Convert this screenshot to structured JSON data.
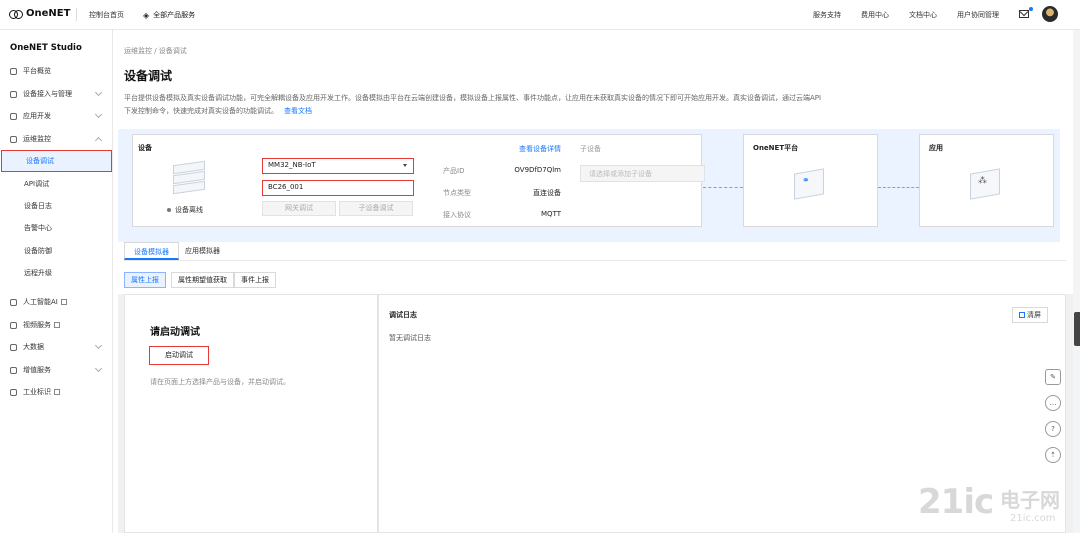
{
  "topbar": {
    "logo": "OneNET",
    "console_home": "控制台首页",
    "all_products": "全部产品服务",
    "right_links": [
      "服务支持",
      "费用中心",
      "文档中心",
      "用户协同管理"
    ]
  },
  "sidebar": {
    "title": "OneNET Studio",
    "items": [
      {
        "label": "平台概览"
      },
      {
        "label": "设备接入与管理"
      },
      {
        "label": "应用开发"
      },
      {
        "label": "运维监控"
      },
      {
        "label": "设备调试"
      },
      {
        "label": "API调试"
      },
      {
        "label": "设备日志"
      },
      {
        "label": "告警中心"
      },
      {
        "label": "设备防御"
      },
      {
        "label": "远程升级"
      },
      {
        "label": "人工智能AI"
      },
      {
        "label": "视频服务"
      },
      {
        "label": "大数据"
      },
      {
        "label": "增值服务"
      },
      {
        "label": "工业标识"
      }
    ]
  },
  "main": {
    "breadcrumb": "运维监控 / 设备调试",
    "title": "设备调试",
    "description": "平台提供设备模拟及真实设备调试功能，可完全解耦设备及应用开发工作。设备模拟由平台在云端创建设备，模拟设备上报属性、事件功能点，让应用在未获取真实设备的情况下即可开始应用开发。真实设备调试，通过云端API下发控制命令，快速完成对真实设备的功能调试。",
    "doc_link": "查看文档"
  },
  "topology": {
    "device_title": "设备",
    "device_status": "设备离线",
    "product_select": "MM32_NB-IoT",
    "device_input": "BC26_001",
    "gateway_btn": "网关调试",
    "subdevice_btn": "子设备调试",
    "view_detail": "查看设备详情",
    "product_id_label": "产品ID",
    "product_id_value": "OV9DfD7Qlm",
    "node_type_label": "节点类型",
    "node_type_value": "直连设备",
    "protocol_label": "接入协议",
    "protocol_value": "MQTT",
    "subdevice_label": "子设备",
    "subdevice_placeholder": "请选择或添加子设备",
    "platform_title": "OneNET平台",
    "app_title": "应用"
  },
  "tabs": [
    "设备模拟器",
    "应用模拟器"
  ],
  "subtabs": [
    "属性上报",
    "属性期望值获取",
    "事件上报"
  ],
  "left_panel": {
    "title": "请启动调试",
    "start_btn": "启动调试",
    "hint": "请在页面上方选择产品与设备，并启动调试。"
  },
  "right_panel": {
    "title": "调试日志",
    "clear_btn": "清屏",
    "empty": "暂无调试日志"
  },
  "watermark": {
    "brand": "21ic",
    "cn": "电子网",
    "domain": "21ic.com"
  }
}
